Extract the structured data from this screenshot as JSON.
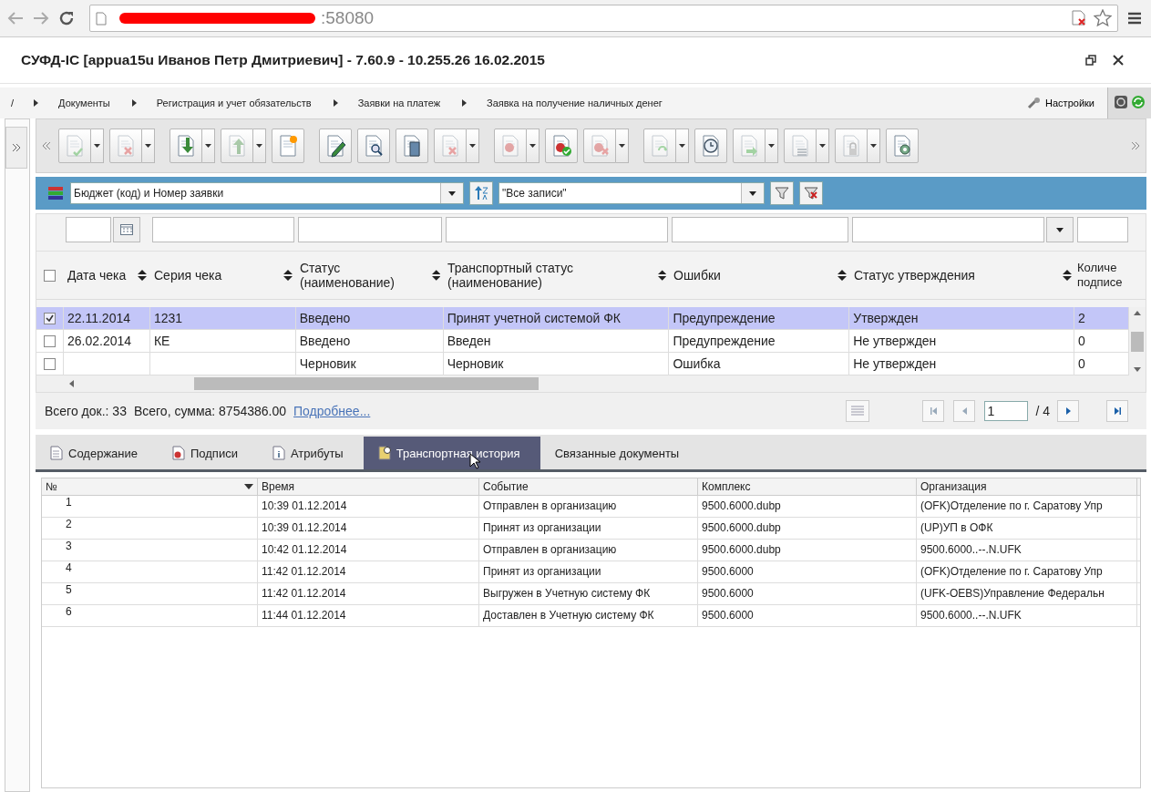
{
  "browser": {
    "address": ":58080"
  },
  "window": {
    "title": "СУФД-IC [appua15u Иванов Петр Дмитриевич] - 7.60.9 - 10.255.26 16.02.2015"
  },
  "breadcrumb": [
    "/",
    "Документы",
    "Регистрация и учет обязательств",
    "Заявки на платеж",
    "Заявка на получение наличных денег"
  ],
  "settings": {
    "label": "Настройки"
  },
  "toolbar": [
    {
      "kind": "sign",
      "dropdown": true,
      "disabled": true
    },
    {
      "kind": "unsign",
      "dropdown": true,
      "disabled": true
    },
    {
      "kind": "import",
      "dropdown": true,
      "disabled": false
    },
    {
      "kind": "export",
      "dropdown": true,
      "disabled": true
    },
    {
      "kind": "new",
      "dropdown": false,
      "disabled": false
    },
    {
      "kind": "edit",
      "dropdown": false,
      "disabled": false
    },
    {
      "kind": "view",
      "dropdown": false,
      "disabled": false
    },
    {
      "kind": "copy",
      "dropdown": false,
      "disabled": false
    },
    {
      "kind": "delete",
      "dropdown": true,
      "disabled": true
    },
    {
      "kind": "stamp",
      "dropdown": true,
      "disabled": true
    },
    {
      "kind": "stamp-ok",
      "dropdown": false,
      "disabled": false
    },
    {
      "kind": "stamp-x",
      "dropdown": true,
      "disabled": true
    },
    {
      "kind": "refresh",
      "dropdown": true,
      "disabled": true
    },
    {
      "kind": "history",
      "dropdown": false,
      "disabled": false
    },
    {
      "kind": "send",
      "dropdown": true,
      "disabled": true
    },
    {
      "kind": "list",
      "dropdown": true,
      "disabled": true
    },
    {
      "kind": "lock",
      "dropdown": true,
      "disabled": true
    },
    {
      "kind": "config",
      "dropdown": false,
      "disabled": false
    }
  ],
  "filter_bar": {
    "sort_field": "Бюджет (код) и Номер заявки",
    "record_filter": "\"Все записи\""
  },
  "grid": {
    "all_checked": false,
    "columns": [
      "Дата чека",
      "Серия чека",
      "Статус (наименование)",
      "Транспортный статус (наименование)",
      "Ошибки",
      "Статус утверждения",
      "Количе подписе"
    ],
    "rows": [
      {
        "selected": true,
        "checked": true,
        "cells": [
          "22.11.2014",
          "1231",
          "Введено",
          "Принят учетной системой ФК",
          "Предупреждение",
          "Утвержден",
          "2"
        ]
      },
      {
        "selected": false,
        "checked": false,
        "cells": [
          "26.02.2014",
          "КЕ",
          "Введено",
          "Введен",
          "Предупреждение",
          "Не утвержден",
          "0"
        ]
      },
      {
        "selected": false,
        "checked": false,
        "cells": [
          "",
          "",
          "Черновик",
          "Черновик",
          "Ошибка",
          "Не утвержден",
          "0"
        ]
      }
    ]
  },
  "summary": {
    "count": "Всего док.: 33",
    "sum": "Всего, сумма: 8754386.00",
    "more_link": "Подробнее..."
  },
  "pager": {
    "page": "1",
    "total": "/ 4"
  },
  "tabs": [
    {
      "label": "Содержание",
      "selected": false
    },
    {
      "label": "Подписи",
      "selected": false
    },
    {
      "label": "Атрибуты",
      "selected": false
    },
    {
      "label": "Транспортная история",
      "selected": true
    },
    {
      "label": "Связанные документы",
      "selected": false
    }
  ],
  "history_table": {
    "columns": [
      "№",
      "Время",
      "Событие",
      "Комплекс",
      "Организация"
    ],
    "rows": [
      [
        "1",
        "10:39 01.12.2014",
        "Отправлен в организацию",
        "9500.6000.dubp",
        "(OFK)Отделение по г. Саратову Упр"
      ],
      [
        "2",
        "10:39 01.12.2014",
        "Принят из организации",
        "9500.6000.dubp",
        "(UP)УП в ОФК"
      ],
      [
        "3",
        "10:42 01.12.2014",
        "Отправлен в организацию",
        "9500.6000.dubp",
        "9500.6000..--.N.UFK"
      ],
      [
        "4",
        "11:42 01.12.2014",
        "Принят из организации",
        "9500.6000",
        "(OFK)Отделение по г. Саратову Упр"
      ],
      [
        "5",
        "11:42 01.12.2014",
        "Выгружен в Учетную систему ФК",
        "9500.6000",
        "(UFK-OEBS)Управление Федеральн"
      ],
      [
        "6",
        "11:44 01.12.2014",
        "Доставлен в Учетную систему ФК",
        "9500.6000",
        "9500.6000..--.N.UFK"
      ]
    ]
  }
}
